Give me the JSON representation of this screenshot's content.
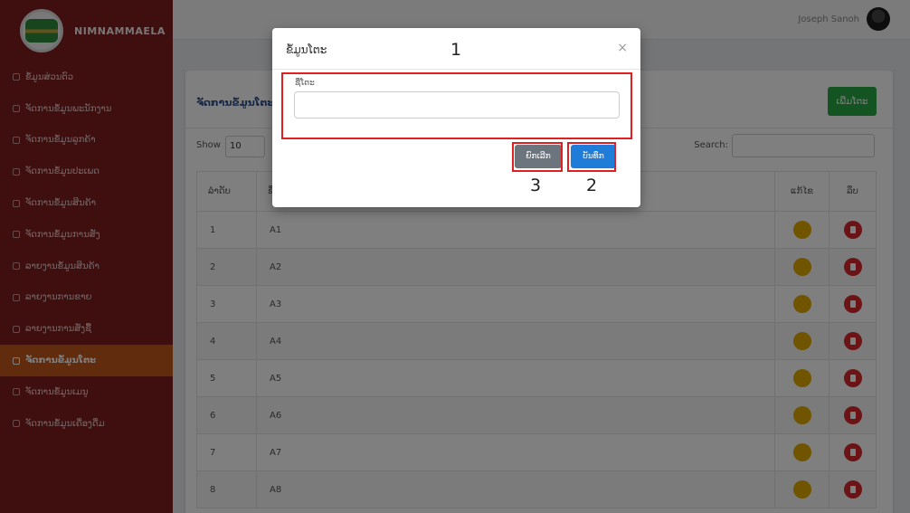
{
  "sidebar": {
    "brand": "NIMNAMMAELA",
    "items": [
      {
        "label": "ຂໍ້ມູນສ່ວນຕົວ",
        "active": false
      },
      {
        "label": "ຈັດການຂໍ້ມູນພະນັກງານ",
        "active": false
      },
      {
        "label": "ຈັດການຂໍ້ມູນລູກຄ້າ",
        "active": false
      },
      {
        "label": "ຈັດການຂໍ້ມູນປະເພດ",
        "active": false
      },
      {
        "label": "ຈັດການຂໍ້ມູນສິນຄ້າ",
        "active": false
      },
      {
        "label": "ຈັດການຂໍ້ມູນການສັ່ງ",
        "active": false
      },
      {
        "label": "ລາຍງານຂໍ້ມູນສິນຄ້າ",
        "active": false
      },
      {
        "label": "ລາຍງານການຂາຍ",
        "active": false
      },
      {
        "label": "ລາຍງານການສັ່ງຊື້",
        "active": false
      },
      {
        "label": "ຈັດການຂໍ້ມູນໂຕະ",
        "active": true
      },
      {
        "label": "ຈັດການຂໍ້ມູນເມນູ",
        "active": false
      },
      {
        "label": "ຈັດການຂໍ້ມູນເຄື່ອງດື່ມ",
        "active": false
      }
    ]
  },
  "topbar": {
    "user_name": "Joseph Sanoh"
  },
  "card": {
    "title": "ຈັດການຂໍ້ມູນໂຕະ",
    "add_button": "ເພີ່ມໂຕະ",
    "show_label": "Show",
    "entries_value": "10",
    "search_label": "Search:",
    "columns": {
      "index": "ລຳດັບ",
      "name": "ຊື່ໂຕະ",
      "edit": "ແກ້ໄຂ",
      "delete": "ລຶບ"
    },
    "rows": [
      {
        "index": "1",
        "name": "A1"
      },
      {
        "index": "2",
        "name": "A2"
      },
      {
        "index": "3",
        "name": "A3"
      },
      {
        "index": "4",
        "name": "A4"
      },
      {
        "index": "5",
        "name": "A5"
      },
      {
        "index": "6",
        "name": "A6"
      },
      {
        "index": "7",
        "name": "A7"
      },
      {
        "index": "8",
        "name": "A8"
      }
    ]
  },
  "modal": {
    "title": "ຂໍ້ມູນໂຕະ",
    "close_symbol": "×",
    "field_label": "ຊື່ໂຕະ",
    "field_value": "",
    "cancel_button": "ຍົກເລີກ",
    "save_button": "ບັນທຶກ"
  },
  "annotations": {
    "box1": "1",
    "box2": "2",
    "box3": "3"
  },
  "colors": {
    "sidebar": "#7e1c1c",
    "active_item": "#c3591c",
    "annotation": "#e02020",
    "save": "#1f7cd8",
    "cancel": "#6c757d",
    "add": "#28a745"
  }
}
